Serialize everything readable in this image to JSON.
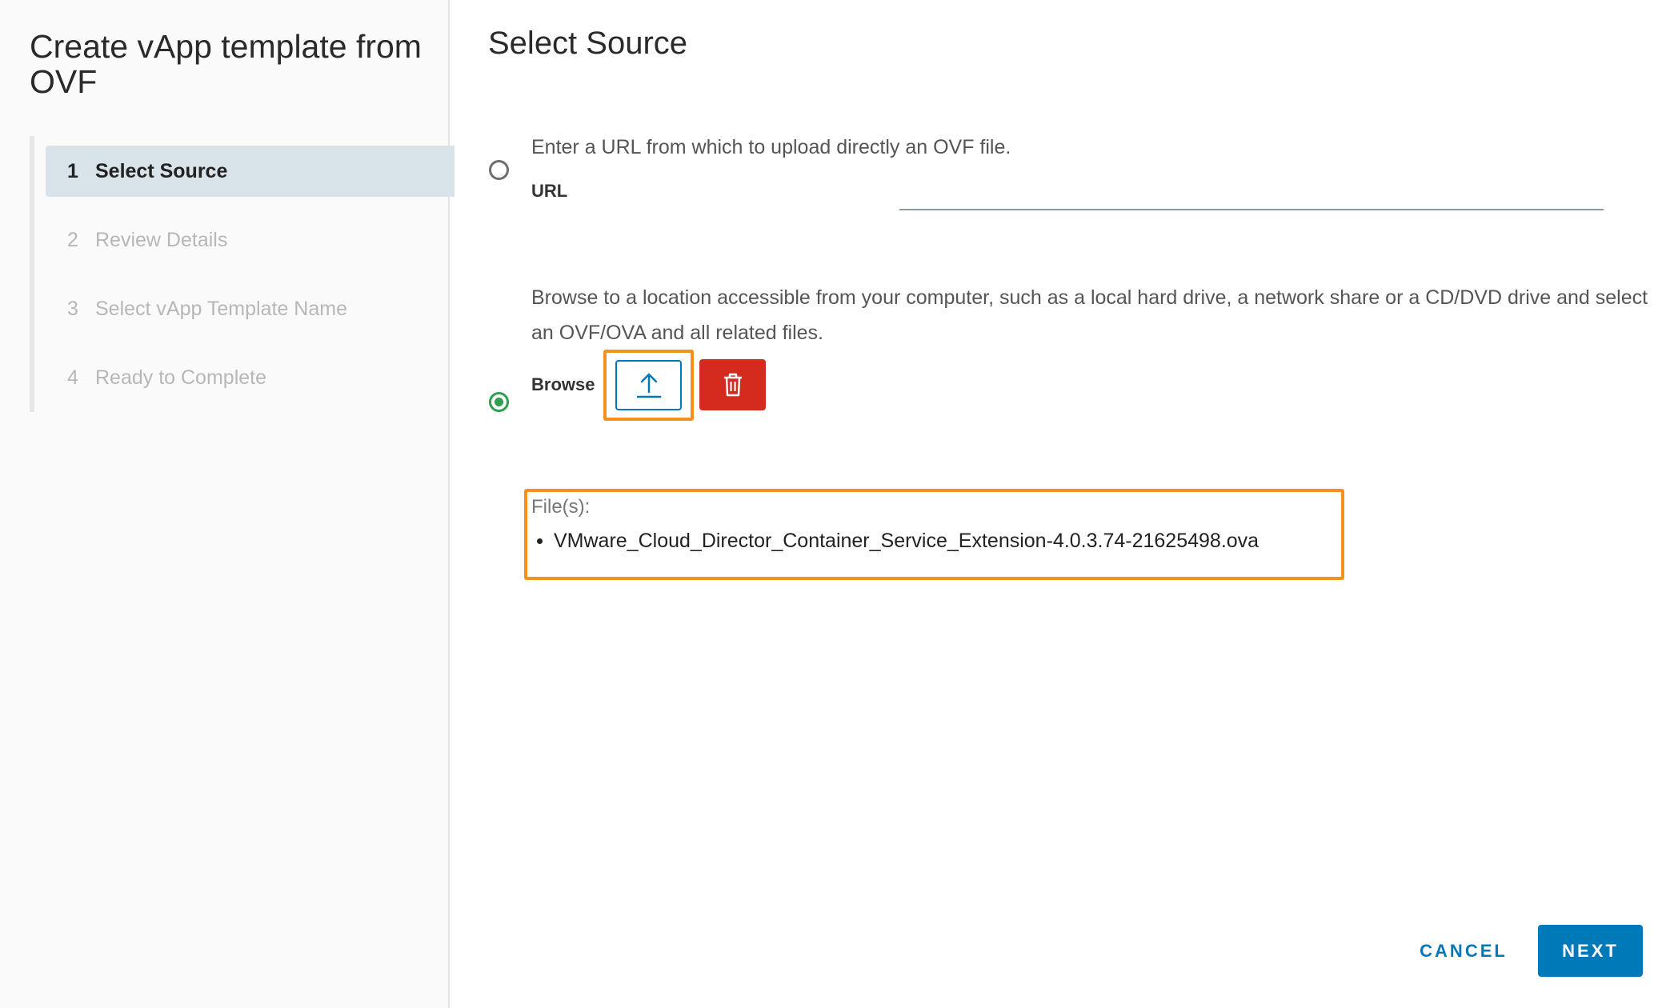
{
  "sidebar": {
    "title": "Create vApp template from OVF",
    "steps": [
      {
        "number": "1",
        "label": "Select Source",
        "active": true
      },
      {
        "number": "2",
        "label": "Review Details",
        "active": false
      },
      {
        "number": "3",
        "label": "Select vApp Template Name",
        "active": false
      },
      {
        "number": "4",
        "label": "Ready to Complete",
        "active": false
      }
    ]
  },
  "main": {
    "title": "Select Source",
    "url_option": {
      "help_text": "Enter a URL from which to upload directly an OVF file.",
      "label": "URL",
      "value": "",
      "selected": false
    },
    "browse_option": {
      "help_text": "Browse to a location accessible from your computer, such as a local hard drive, a network share or a CD/DVD drive and select an OVF/OVA and all related files.",
      "label": "Browse",
      "selected": true,
      "upload_icon": "upload-icon",
      "delete_icon": "trash-icon"
    },
    "files": {
      "label": "File(s):",
      "items": [
        "VMware_Cloud_Director_Container_Service_Extension-4.0.3.74-21625498.ova"
      ]
    }
  },
  "footer": {
    "cancel_label": "CANCEL",
    "next_label": "NEXT"
  },
  "colors": {
    "primary": "#0079b8",
    "danger": "#d52b1e",
    "highlight": "#f2911e",
    "radio_checked": "#2f9e4e",
    "active_step_bg": "#d8e3ea"
  }
}
